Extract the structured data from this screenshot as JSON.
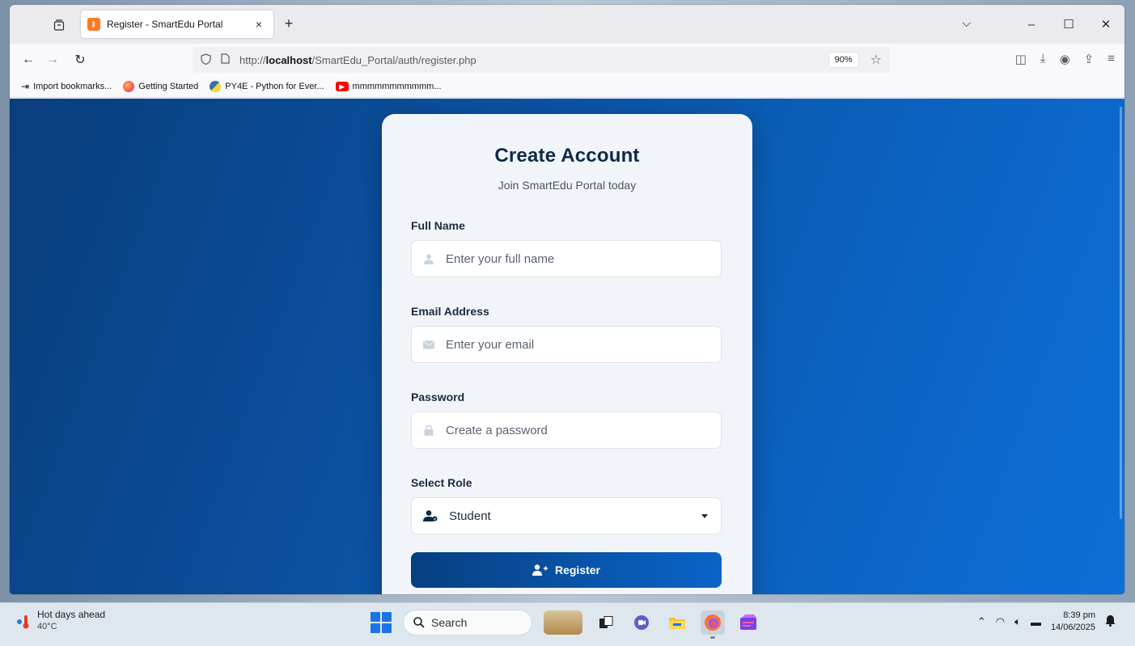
{
  "browser": {
    "tab_title": "Register - SmartEdu Portal",
    "tab_close": "×",
    "new_tab": "+",
    "url_prefix": "http://",
    "url_host": "localhost",
    "url_path": "/SmartEdu_Portal/auth/register.php",
    "zoom": "90%"
  },
  "bookmarks": [
    {
      "label": "Import bookmarks...",
      "icon": "import-icon"
    },
    {
      "label": "Getting Started",
      "icon": "firefox-icon"
    },
    {
      "label": "PY4E - Python for Ever...",
      "icon": "python-icon"
    },
    {
      "label": "mmmmmmmmmmm...",
      "icon": "youtube-icon"
    }
  ],
  "form": {
    "title": "Create Account",
    "subtitle": "Join SmartEdu Portal today",
    "full_name_label": "Full Name",
    "full_name_placeholder": "Enter your full name",
    "email_label": "Email Address",
    "email_placeholder": "Enter your email",
    "password_label": "Password",
    "password_placeholder": "Create a password",
    "role_label": "Select Role",
    "role_selected": "Student",
    "register_label": "Register"
  },
  "taskbar": {
    "weather_title": "Hot days ahead",
    "weather_temp": "40°C",
    "search_label": "Search",
    "time": "8:39 pm",
    "date": "14/06/2025"
  },
  "colors": {
    "page_bg_start": "#0a3d7c",
    "page_bg_end": "#0d6fd8",
    "button_start": "#063f80",
    "button_end": "#0b64c8",
    "title": "#0e2a47"
  }
}
